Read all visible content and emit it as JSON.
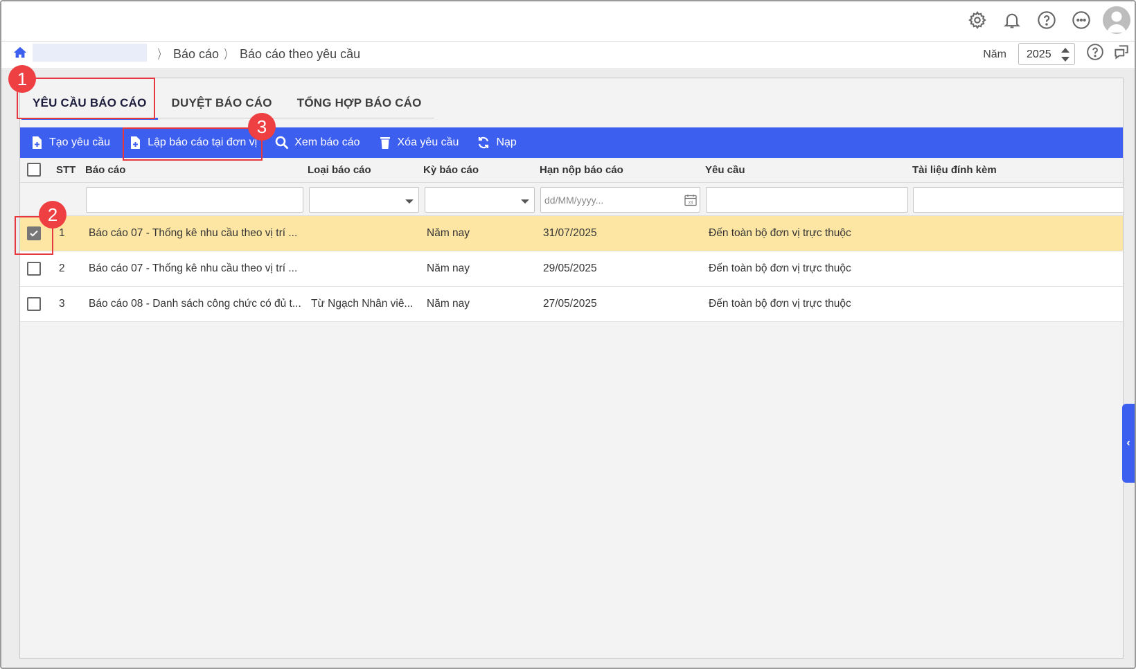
{
  "topbar": {
    "icons": [
      "gear-icon",
      "bell-icon",
      "help-icon",
      "more-icon",
      "avatar-icon"
    ]
  },
  "breadcrumb": {
    "items": [
      "Báo cáo",
      "Báo cáo theo yêu cầu"
    ],
    "year_label": "Năm",
    "year_value": "2025"
  },
  "tabs": [
    {
      "label": "YÊU CẦU BÁO CÁO",
      "active": true
    },
    {
      "label": "DUYỆT BÁO CÁO",
      "active": false
    },
    {
      "label": "TỔNG HỢP BÁO CÁO",
      "active": false
    }
  ],
  "toolbar": {
    "create": "Tạo yêu cầu",
    "prepare": "Lập báo cáo tại đơn vị",
    "view": "Xem báo cáo",
    "delete": "Xóa yêu cầu",
    "reload": "Nạp"
  },
  "columns": {
    "stt": "STT",
    "report": "Báo cáo",
    "type": "Loại báo cáo",
    "period": "Kỳ báo cáo",
    "deadline": "Hạn nộp báo cáo",
    "request": "Yêu cầu",
    "attachment": "Tài liệu đính kèm"
  },
  "filters": {
    "date_placeholder": "dd/MM/yyyy..."
  },
  "rows": [
    {
      "stt": "1",
      "report": "Báo cáo 07 - Thống kê nhu cầu theo vị trí ...",
      "type": "",
      "period": "Năm nay",
      "deadline": "31/07/2025",
      "request": "Đến toàn bộ đơn vị trực thuộc",
      "checked": true
    },
    {
      "stt": "2",
      "report": "Báo cáo 07 - Thống kê nhu cầu theo vị trí ...",
      "type": "",
      "period": "Năm nay",
      "deadline": "29/05/2025",
      "request": "Đến toàn bộ đơn vị trực thuộc",
      "checked": false
    },
    {
      "stt": "3",
      "report": "Báo cáo 08 - Danh sách công chức có đủ t...",
      "type": "Từ Ngạch Nhân viê...",
      "period": "Năm nay",
      "deadline": "27/05/2025",
      "request": "Đến toàn bộ đơn vị trực thuộc",
      "checked": false
    }
  ],
  "annotations": [
    "1",
    "2",
    "3"
  ],
  "colors": {
    "accent": "#3d5fef",
    "selected_row": "#fde6a3",
    "annotation": "#ee3f42"
  }
}
